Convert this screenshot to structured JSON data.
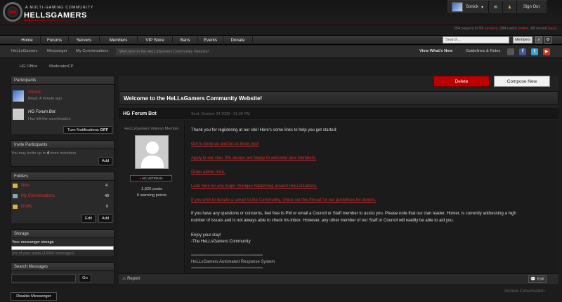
{
  "header": {
    "tagline": "A MULTI-GAMING COMMUNITY",
    "logo": "HELLSGAMERS",
    "user_name": "Sonick",
    "signout_label": "Sign Out"
  },
  "stats": {
    "players": "354 players in 59",
    "servers": "servers",
    "users": ", 284 users",
    "online": "online",
    "recent": ", 89 recent",
    "bans": "bans."
  },
  "nav": {
    "items": [
      "Home",
      "Forums",
      "Servers",
      "Members",
      "VIP Store",
      "Bans",
      "Events",
      "Donate"
    ],
    "search_placeholder": "Search...",
    "members_label": "Members"
  },
  "subnav": {
    "items": [
      "HeLLsGamers",
      "Messenger",
      "My Conversations"
    ],
    "breadcrumb": "Welcome to the HeLLsGamers Community Website!",
    "view_whats_new": "View What's New",
    "guidelines": "Guidelines & Rules"
  },
  "tabs2": [
    "HG Office",
    "ModeratorCP"
  ],
  "participants": {
    "title": "Participants",
    "p1_name": "Sonick",
    "p1_status": "Read: A minute ago",
    "p2_name": "HG Forum Bot",
    "p2_status": "Has left the conversation",
    "notif_label": "Turn Notifications",
    "notif_state": "OFF"
  },
  "invite": {
    "title": "Invite Participants",
    "text_pre": "You may invite up to",
    "count": "4",
    "text_post": "more members",
    "add_label": "Add"
  },
  "folders": {
    "title": "Folders",
    "items": [
      {
        "name": "New",
        "count": "4"
      },
      {
        "name": "My Conversations",
        "count": "40"
      },
      {
        "name": "Drafts",
        "count": "0"
      }
    ],
    "edit_label": "Edit",
    "add_label": "Add"
  },
  "storage": {
    "title": "Storage",
    "label": "Your messenger storage",
    "quota": "0% of your quota (10000 messages)"
  },
  "search_messages": {
    "title": "Search Messages",
    "go_label": "Go"
  },
  "disable_label": "Disable Messenger",
  "actions": {
    "delete_label": "Delete",
    "compose_label": "Compose New"
  },
  "conversation": {
    "title": "Welcome to the HeLLsGamers Community Website!",
    "author": "HG Forum Bot",
    "sent": "Sent: October 24 2009 - 01:26 PM",
    "rank": "HeLLsGamers Veteran Member",
    "badge": "HG VETERAN",
    "posts": "1,526 posts",
    "warnings": "0 warning points",
    "intro": "Thank you for registering at our site! Here's some links to help you get started:",
    "links": [
      "Get to know us and let us know you!",
      "Apply to our clan. We always are happy to welcome new members.",
      "Order admin here.",
      "Look here for any major changes happening around HeLLsGamers.",
      "If you wish to donate a server to the Community, check out this thread for our guidelines for donors."
    ],
    "para1": "If you have any questions or concerns, feel free to PM or email a Council or Staff member to assist you. Please note that our clan leader, Homer, is currently addressing a high",
    "para2": "number of issues and is not always able to check his inbox. However, any other member of our Staff or Council will readily be able to aid you.",
    "enjoy": "Enjoy your stay!",
    "sign": "-The HeLLsGamers Community",
    "divider": "==================================",
    "auto": "HeLLsGamers Automated Response System",
    "report_label": "Report",
    "edit_label": "Edit",
    "archive_label": "Archive Conversation"
  }
}
